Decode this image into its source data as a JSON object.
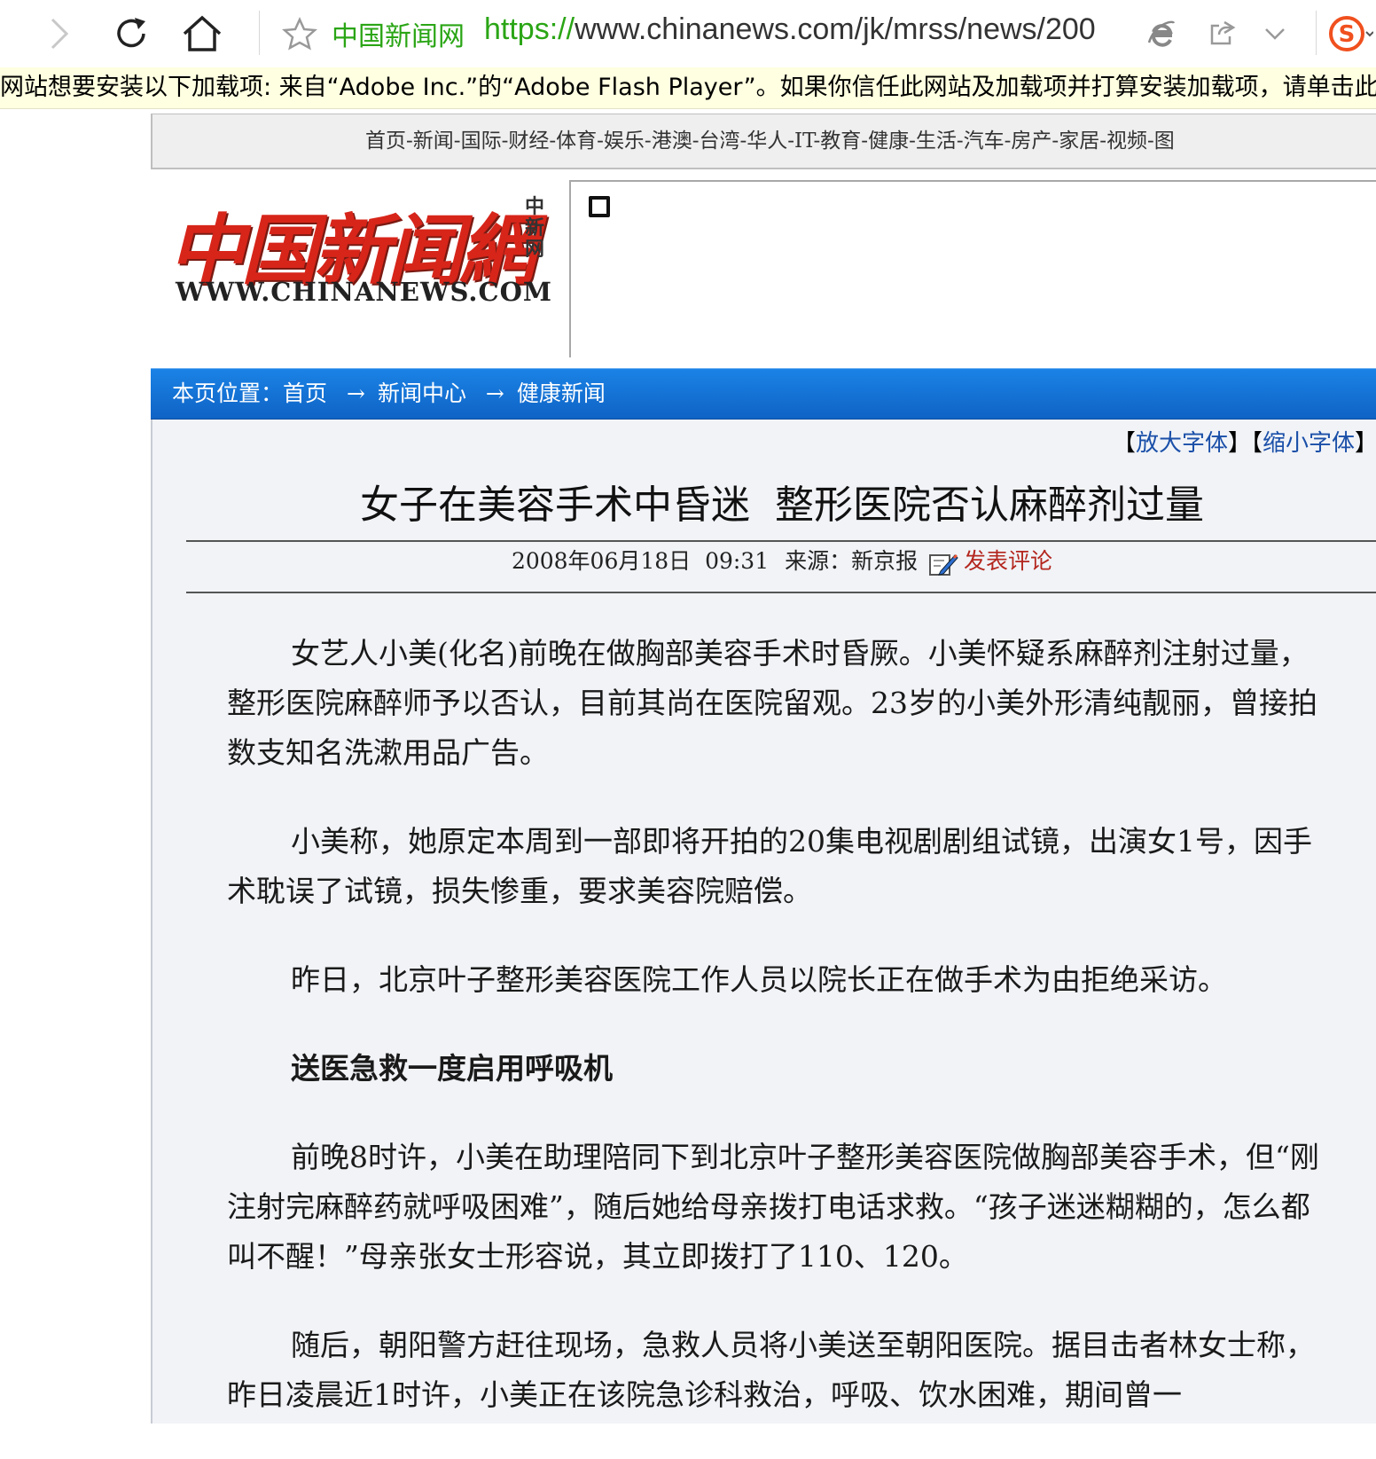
{
  "browser": {
    "site_name": "中国新闻网",
    "url_scheme": "https://",
    "url_rest": "www.chinanews.com/jk/mrss/news/200",
    "notification": "网站想要安装以下加载项: 来自“Adobe Inc.”的“Adobe Flash Player”。如果你信任此网站及加载项并打算安装加载项，请单击此处..."
  },
  "site_nav": [
    "首页",
    "新闻",
    "国际",
    "财经",
    "体育",
    "娱乐",
    "港澳",
    "台湾",
    "华人",
    "IT",
    "教育",
    "健康",
    "生活",
    "汽车",
    "房产",
    "家居",
    "视频",
    "图"
  ],
  "logo": {
    "chinese": "中国新闻網",
    "vertical": "中新网",
    "english": "WWW.CHINANEWS.COM"
  },
  "breadcrumb": {
    "label": "本页位置：",
    "items": [
      "首页",
      "新闻中心",
      "健康新闻"
    ],
    "arrow": "→"
  },
  "font_controls": {
    "enlarge": "放大字体",
    "shrink": "缩小字体"
  },
  "article": {
    "title": "女子在美容手术中昏迷  整形医院否认麻醉剂过量",
    "datetime": "2008年06月18日  09:31",
    "source": "来源：新京报",
    "comment_link": "发表评论",
    "paragraphs": [
      "女艺人小美(化名)前晚在做胸部美容手术时昏厥。小美怀疑系麻醉剂注射过量，整形医院麻醉师予以否认，目前其尚在医院留观。23岁的小美外形清纯靓丽，曾接拍数支知名洗漱用品广告。",
      "小美称，她原定本周到一部即将开拍的20集电视剧剧组试镜，出演女1号，因手术耽误了试镜，损失惨重，要求美容院赔偿。",
      "昨日，北京叶子整形美容医院工作人员以院长正在做手术为由拒绝采访。"
    ],
    "subheading": "送医急救一度启用呼吸机",
    "paragraphs2": [
      "前晚8时许，小美在助理陪同下到北京叶子整形美容医院做胸部美容手术，但“刚注射完麻醉药就呼吸困难”，随后她给母亲拨打电话求救。“孩子迷迷糊糊的，怎么都叫不醒！”母亲张女士形容说，其立即拨打了110、120。",
      "随后，朝阳警方赶往现场，急救人员将小美送至朝阳医院。据目击者林女士称，昨日凌晨近1时许，小美正在该院急诊科救治，呼吸、饮水困难，期间曾一"
    ]
  }
}
